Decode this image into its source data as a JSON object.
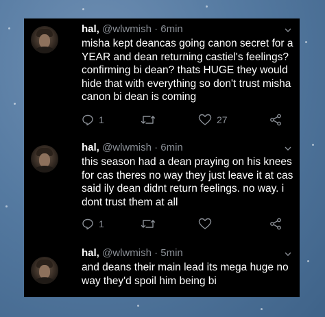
{
  "tweets": [
    {
      "name": "hal,",
      "handle": "@wlwmish",
      "sep": "·",
      "time": "6min",
      "lines": [
        "misha kept deancas going canon secret for a",
        "YEAR and dean returning castiel's feelings?",
        "confirming bi dean? thats HUGE they would",
        "hide that with everything so don't trust misha",
        "canon bi dean is coming"
      ],
      "replies": "1",
      "likes": "27"
    },
    {
      "name": "hal,",
      "handle": "@wlwmish",
      "sep": "·",
      "time": "6min",
      "lines": [
        "this season had a dean praying on his knees",
        "for cas theres no way they just leave it at cas",
        "said ily dean didnt return feelings. no way. i",
        "dont trust them at all"
      ],
      "replies": "1",
      "likes": ""
    },
    {
      "name": "hal,",
      "handle": "@wlwmish",
      "sep": "·",
      "time": "5min",
      "lines": [
        "and deans their main lead its mega huge no",
        "way they'd spoil him being bi"
      ]
    }
  ],
  "icons": {
    "reply": "reply-icon",
    "retweet": "retweet-icon",
    "like": "heart-icon",
    "share": "share-icon",
    "menu": "chevron-down-icon"
  },
  "colors": {
    "panel": "#000000",
    "text": "#ffffff",
    "muted": "#8a8f96",
    "background": "#5679a0"
  }
}
